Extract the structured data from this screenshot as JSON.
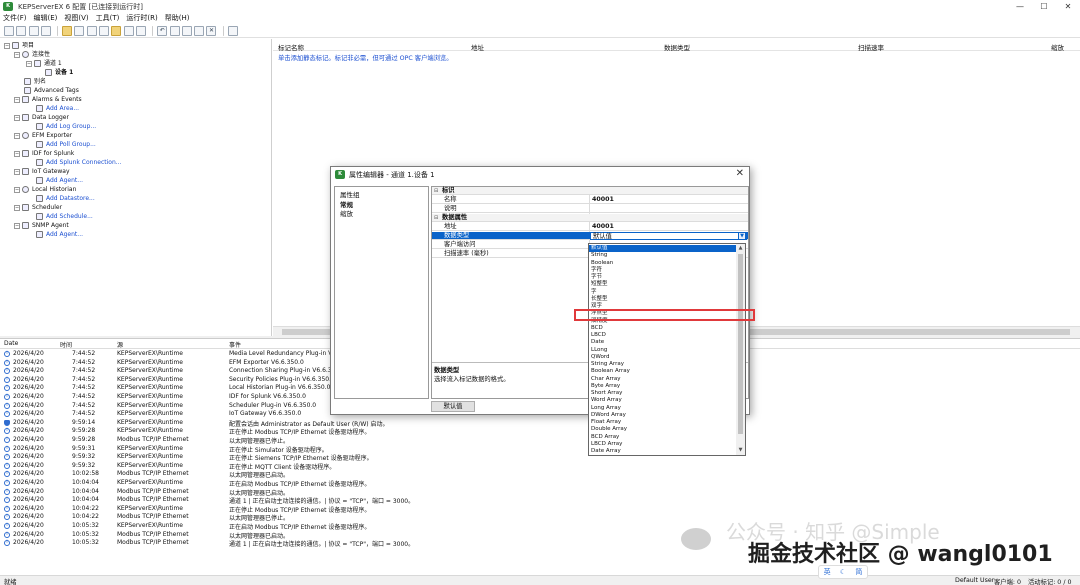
{
  "window": {
    "title": "KEPServerEX 6 配置 [已连接到运行时]",
    "controls": [
      "—",
      "☐",
      "✕"
    ]
  },
  "menu": [
    "文件(F)",
    "编辑(E)",
    "视图(V)",
    "工具(T)",
    "运行时(R)",
    "帮助(H)"
  ],
  "tree": {
    "root": "项目",
    "connectivity": "连接性",
    "channel": "通道 1",
    "device": "设备 1",
    "alias": "别名",
    "advanced_tags": "Advanced Tags",
    "alarms": "Alarms & Events",
    "add_area": "Add Area...",
    "data_logger": "Data Logger",
    "add_log_group": "Add Log Group...",
    "efm": "EFM Exporter",
    "add_poll_group": "Add Poll Group...",
    "idf": "IDF for Splunk",
    "add_splunk": "Add Splunk Connection...",
    "iot": "IoT Gateway",
    "add_agent": "Add Agent...",
    "historian": "Local Historian",
    "add_datastore": "Add Datastore...",
    "scheduler": "Scheduler",
    "add_schedule": "Add Schedule...",
    "snmp": "SNMP Agent",
    "add_agent2": "Add Agent..."
  },
  "taglist": {
    "columns": [
      "标记名称",
      "地址",
      "数据类型",
      "扫描速率",
      "缩放"
    ],
    "hint": "单击添加静态标记。标记非必需，但可通过 OPC 客户端浏览。"
  },
  "log": {
    "columns": [
      "Date",
      "时间",
      "源",
      "事件"
    ],
    "rows": [
      {
        "date": "2026/4/20",
        "time": "7:44:52",
        "src": "KEPServerEX\\Runtime",
        "evt": "Media Level Redundancy Plug-in V6.6",
        "lvl": "i"
      },
      {
        "date": "2026/4/20",
        "time": "7:44:52",
        "src": "KEPServerEX\\Runtime",
        "evt": "EFM Exporter V6.6.350.0",
        "lvl": "i"
      },
      {
        "date": "2026/4/20",
        "time": "7:44:52",
        "src": "KEPServerEX\\Runtime",
        "evt": "Connection Sharing Plug-in V6.6.350.0",
        "lvl": "i"
      },
      {
        "date": "2026/4/20",
        "time": "7:44:52",
        "src": "KEPServerEX\\Runtime",
        "evt": "Security Policies Plug-in V6.6.350.0",
        "lvl": "i"
      },
      {
        "date": "2026/4/20",
        "time": "7:44:52",
        "src": "KEPServerEX\\Runtime",
        "evt": "Local Historian Plug-in V6.6.350.0",
        "lvl": "i"
      },
      {
        "date": "2026/4/20",
        "time": "7:44:52",
        "src": "KEPServerEX\\Runtime",
        "evt": "IDF for Splunk V6.6.350.0",
        "lvl": "i"
      },
      {
        "date": "2026/4/20",
        "time": "7:44:52",
        "src": "KEPServerEX\\Runtime",
        "evt": "Scheduler Plug-in V6.6.350.0",
        "lvl": "i"
      },
      {
        "date": "2026/4/20",
        "time": "7:44:52",
        "src": "KEPServerEX\\Runtime",
        "evt": "IoT Gateway V6.6.350.0",
        "lvl": "i"
      },
      {
        "date": "2026/4/20",
        "time": "9:59:14",
        "src": "KEPServerEX\\Runtime",
        "evt": "配置会话由 Administrator as Default User (R/W) 启动。",
        "lvl": "sec"
      },
      {
        "date": "2026/4/20",
        "time": "9:59:28",
        "src": "KEPServerEX\\Runtime",
        "evt": "正在停止 Modbus TCP/IP Ethernet 设备驱动程序。",
        "lvl": "i"
      },
      {
        "date": "2026/4/20",
        "time": "9:59:28",
        "src": "Modbus TCP/IP Ethernet",
        "evt": "以太网管理器已停止。",
        "lvl": "i"
      },
      {
        "date": "2026/4/20",
        "time": "9:59:31",
        "src": "KEPServerEX\\Runtime",
        "evt": "正在停止 Simulator 设备驱动程序。",
        "lvl": "i"
      },
      {
        "date": "2026/4/20",
        "time": "9:59:32",
        "src": "KEPServerEX\\Runtime",
        "evt": "正在停止 Siemens TCP/IP Ethernet 设备驱动程序。",
        "lvl": "i"
      },
      {
        "date": "2026/4/20",
        "time": "9:59:32",
        "src": "KEPServerEX\\Runtime",
        "evt": "正在停止 MQTT Client 设备驱动程序。",
        "lvl": "i"
      },
      {
        "date": "2026/4/20",
        "time": "10:02:58",
        "src": "Modbus TCP/IP Ethernet",
        "evt": "以太网管理器已启动。",
        "lvl": "i"
      },
      {
        "date": "2026/4/20",
        "time": "10:04:04",
        "src": "KEPServerEX\\Runtime",
        "evt": "正在启动 Modbus TCP/IP Ethernet 设备驱动程序。",
        "lvl": "i"
      },
      {
        "date": "2026/4/20",
        "time": "10:04:04",
        "src": "Modbus TCP/IP Ethernet",
        "evt": "以太网管理器已启动。",
        "lvl": "i"
      },
      {
        "date": "2026/4/20",
        "time": "10:04:04",
        "src": "Modbus TCP/IP Ethernet",
        "evt": "通道 1 | 正在启动主动连接的通信。| 协议 = \"TCP\"，端口 = 3000。",
        "lvl": "i"
      },
      {
        "date": "2026/4/20",
        "time": "10:04:22",
        "src": "KEPServerEX\\Runtime",
        "evt": "正在停止 Modbus TCP/IP Ethernet 设备驱动程序。",
        "lvl": "i"
      },
      {
        "date": "2026/4/20",
        "time": "10:04:22",
        "src": "Modbus TCP/IP Ethernet",
        "evt": "以太网管理器已停止。",
        "lvl": "i"
      },
      {
        "date": "2026/4/20",
        "time": "10:05:32",
        "src": "KEPServerEX\\Runtime",
        "evt": "正在启动 Modbus TCP/IP Ethernet 设备驱动程序。",
        "lvl": "i"
      },
      {
        "date": "2026/4/20",
        "time": "10:05:32",
        "src": "Modbus TCP/IP Ethernet",
        "evt": "以太网管理器已启动。",
        "lvl": "i"
      },
      {
        "date": "2026/4/20",
        "time": "10:05:32",
        "src": "Modbus TCP/IP Ethernet",
        "evt": "通道 1 | 正在启动主动连接的通信。| 协议 = \"TCP\"，端口 = 3000。",
        "lvl": "i"
      }
    ]
  },
  "status": {
    "left": "就绪",
    "user": "Default User",
    "clients": "客户端: 0",
    "active_tags": "活动标记: 0 / 0"
  },
  "dialog": {
    "title": "属性编辑器 - 通道 1.设备 1",
    "groups_header": "属性组",
    "groups": [
      "常规",
      "缩放"
    ],
    "cat_id": "标识",
    "name_label": "名称",
    "name_value": "40001",
    "desc_label": "说明",
    "cat_data": "数据属性",
    "addr_label": "地址",
    "addr_value": "40001",
    "type_label": "数据类型",
    "type_value": "默认值",
    "access_label": "客户端访问",
    "scan_label": "扫描速率 (毫秒)",
    "help_title": "数据类型",
    "help_text": "选择流入标记数据的格式。",
    "default_button": "默认值"
  },
  "dropdown": {
    "options": [
      "默认值",
      "String",
      "Boolean",
      "字符",
      "字节",
      "短整型",
      "字",
      "长整型",
      "双字",
      "浮点型",
      "双精度",
      "BCD",
      "LBCD",
      "Date",
      "LLong",
      "QWord",
      "String Array",
      "Boolean Array",
      "Char Array",
      "Byte Array",
      "Short Array",
      "Word Array",
      "Long Array",
      "DWord Array",
      "Float Array",
      "Double Array",
      "BCD Array",
      "LBCD Array",
      "Date Array"
    ]
  },
  "watermark": {
    "line1": "公众号 · 知乎 @Simple",
    "line2": "掘金技术社区 @ wangl0101"
  },
  "ime": {
    "lang": "英",
    "mode": "简"
  }
}
